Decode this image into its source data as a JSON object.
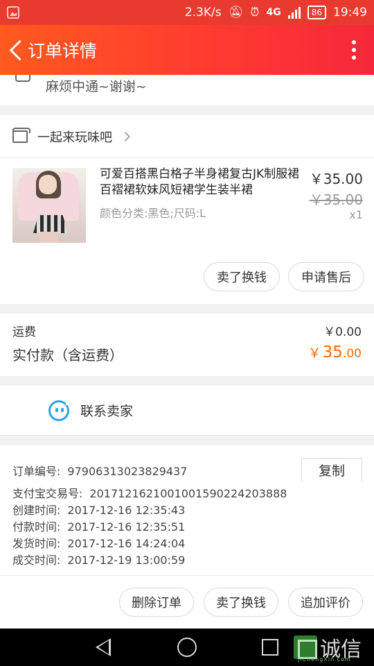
{
  "status_bar": {
    "speed": "2.3K/s",
    "network": "4G",
    "battery": "86",
    "time": "19:49"
  },
  "header": {
    "title": "订单详情"
  },
  "message": {
    "text": "麻烦中通~谢谢~"
  },
  "shop": {
    "name": "一起来玩味吧"
  },
  "product": {
    "title": "可爱百搭黑白格子半身裙复古JK制服裙百褶裙软妹风短裙学生装半裙",
    "spec": "颜色分类:黑色;尺码:L",
    "price": "￥35.00",
    "original_price": "￥35.00",
    "quantity": "x1"
  },
  "item_actions": {
    "sell": "卖了换钱",
    "after_sale": "申请售后"
  },
  "fees": {
    "shipping_label": "运费",
    "shipping_value": "￥0.00",
    "paid_label": "实付款（含运费）",
    "paid_currency": "￥",
    "paid_int": "35",
    "paid_dec": ".00"
  },
  "contact": {
    "label": "联系卖家"
  },
  "order_info": {
    "order_no_label": "订单编号:",
    "order_no": "97906313023829437",
    "copy_label": "复制",
    "alipay_label": "支付宝交易号:",
    "alipay_no": "2017121621001001590224203888",
    "created_label": "创建时间:",
    "created": "2017-12-16 12:35:43",
    "paid_label": "付款时间:",
    "paid": "2017-12-16 12:35:51",
    "shipped_label": "发货时间:",
    "shipped": "2017-12-16 14:24:04",
    "completed_label": "成交时间:",
    "completed": "2017-12-19 13:00:59"
  },
  "bottom_actions": {
    "delete": "删除订单",
    "sell": "卖了换钱",
    "review": "追加评价"
  },
  "watermark": {
    "text": "诚信",
    "sub": "JiChengXin.com"
  },
  "colors": {
    "accent": "#ff3b2f",
    "price_orange": "#ff6a00",
    "contact_blue": "#2aa4e8"
  }
}
